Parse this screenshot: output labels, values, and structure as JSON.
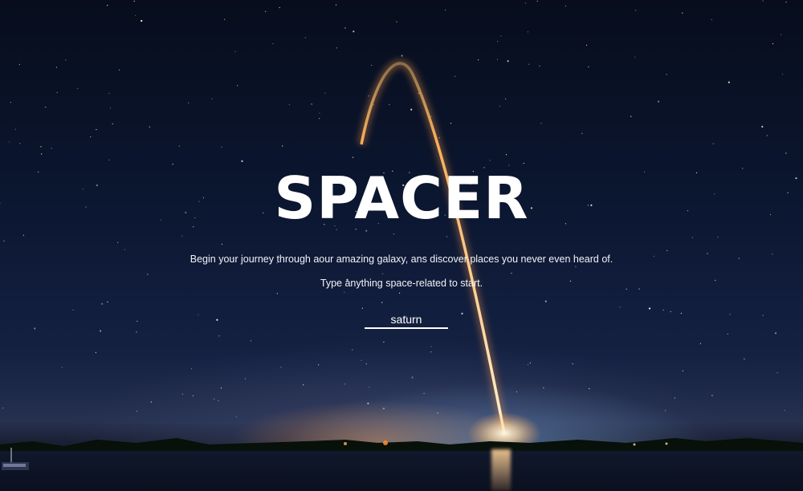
{
  "hero": {
    "title": "SPACER",
    "subtitle": "Begin your journey through aour amazing galaxy, ans discover places you never even heard of.",
    "hint": "Type anything space-related to start."
  },
  "search": {
    "value": "saturn",
    "placeholder": ""
  },
  "colors": {
    "text": "#ffffff",
    "sky_top": "#070d1c",
    "sky_horizon": "#26304f",
    "rocket_trail": "#ffb45a"
  },
  "background": {
    "scene": "night-sky rocket launch over water"
  }
}
